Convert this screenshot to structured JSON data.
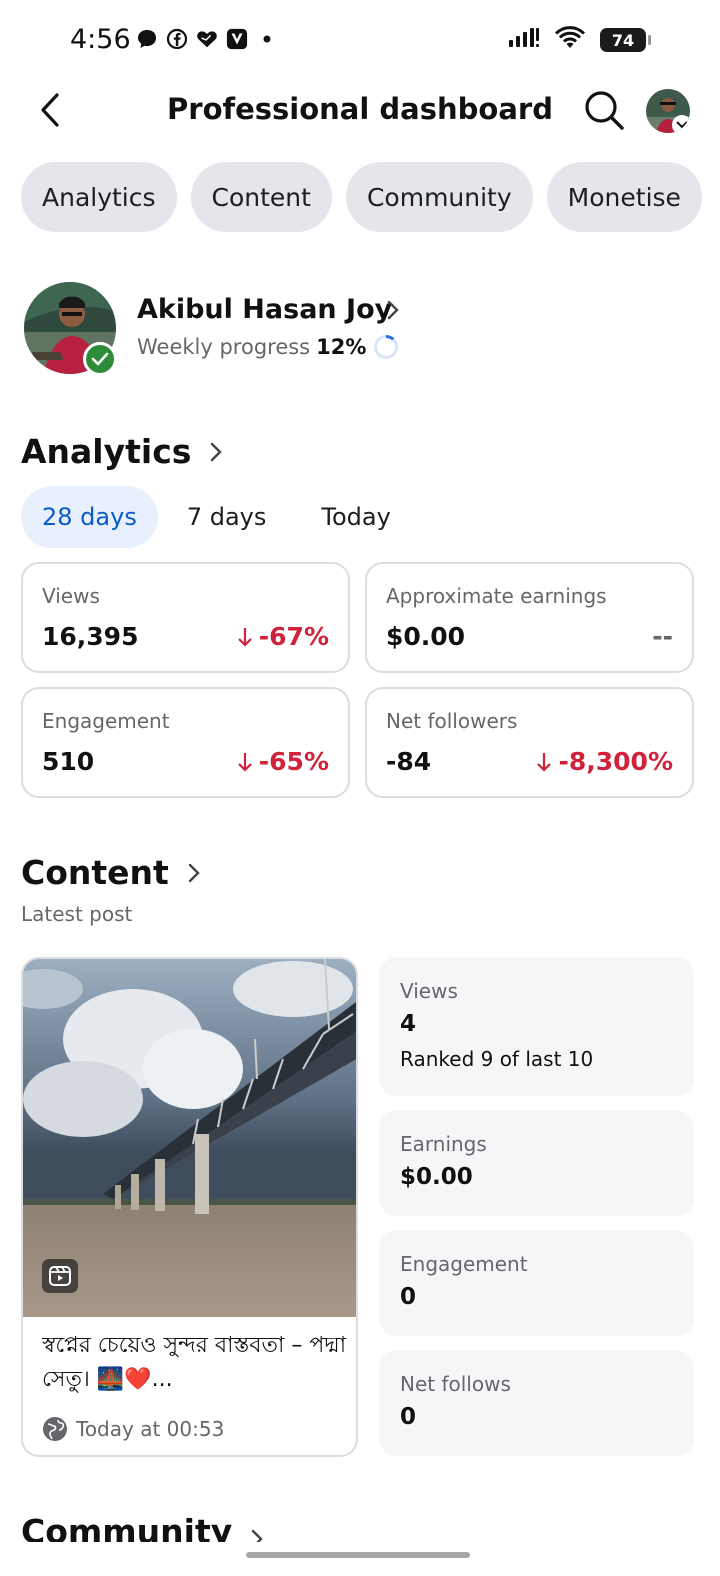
{
  "status_bar": {
    "time": "4:56",
    "battery": "74",
    "left_icons": [
      "chat-bubble-icon",
      "facebook-icon",
      "heart-icon",
      "v-app-icon",
      "dot-icon"
    ],
    "right_icons": [
      "signal-icon",
      "wifi-icon",
      "battery-icon"
    ]
  },
  "header": {
    "title": "Professional dashboard"
  },
  "chips": [
    "Analytics",
    "Content",
    "Community",
    "Monetise"
  ],
  "profile": {
    "name": "Akibul Hasan Joy",
    "progress_label": "Weekly progress",
    "progress_value": "12%",
    "progress_fraction": 0.12
  },
  "analytics": {
    "title": "Analytics",
    "ranges": [
      "28 days",
      "7 days",
      "Today"
    ],
    "active_range": "28 days",
    "cards": [
      {
        "label": "Views",
        "value": "16,395",
        "delta": "-67%",
        "trend": "down"
      },
      {
        "label": "Approximate earnings",
        "value": "$0.00",
        "delta": "--",
        "trend": "none"
      },
      {
        "label": "Engagement",
        "value": "510",
        "delta": "-65%",
        "trend": "down"
      },
      {
        "label": "Net followers",
        "value": "-84",
        "delta": "-8,300%",
        "trend": "down"
      }
    ]
  },
  "content": {
    "title": "Content",
    "subtitle": "Latest post",
    "post": {
      "caption": "স্বপ্নের চেয়েও সুন্দর বাস্তবতা – পদ্মা সেতু। 🌉❤️...",
      "time": "Today at 00:53"
    },
    "stats": [
      {
        "label": "Views",
        "value": "4",
        "sub": "Ranked 9 of last 10"
      },
      {
        "label": "Earnings",
        "value": "$0.00"
      },
      {
        "label": "Engagement",
        "value": "0"
      },
      {
        "label": "Net follows",
        "value": "0"
      }
    ]
  },
  "community": {
    "title": "Community"
  },
  "colors": {
    "accent": "#0b5cc7",
    "negative": "#d1223c",
    "chip_bg": "#e4e6eb",
    "verified": "#2e8b3a"
  }
}
